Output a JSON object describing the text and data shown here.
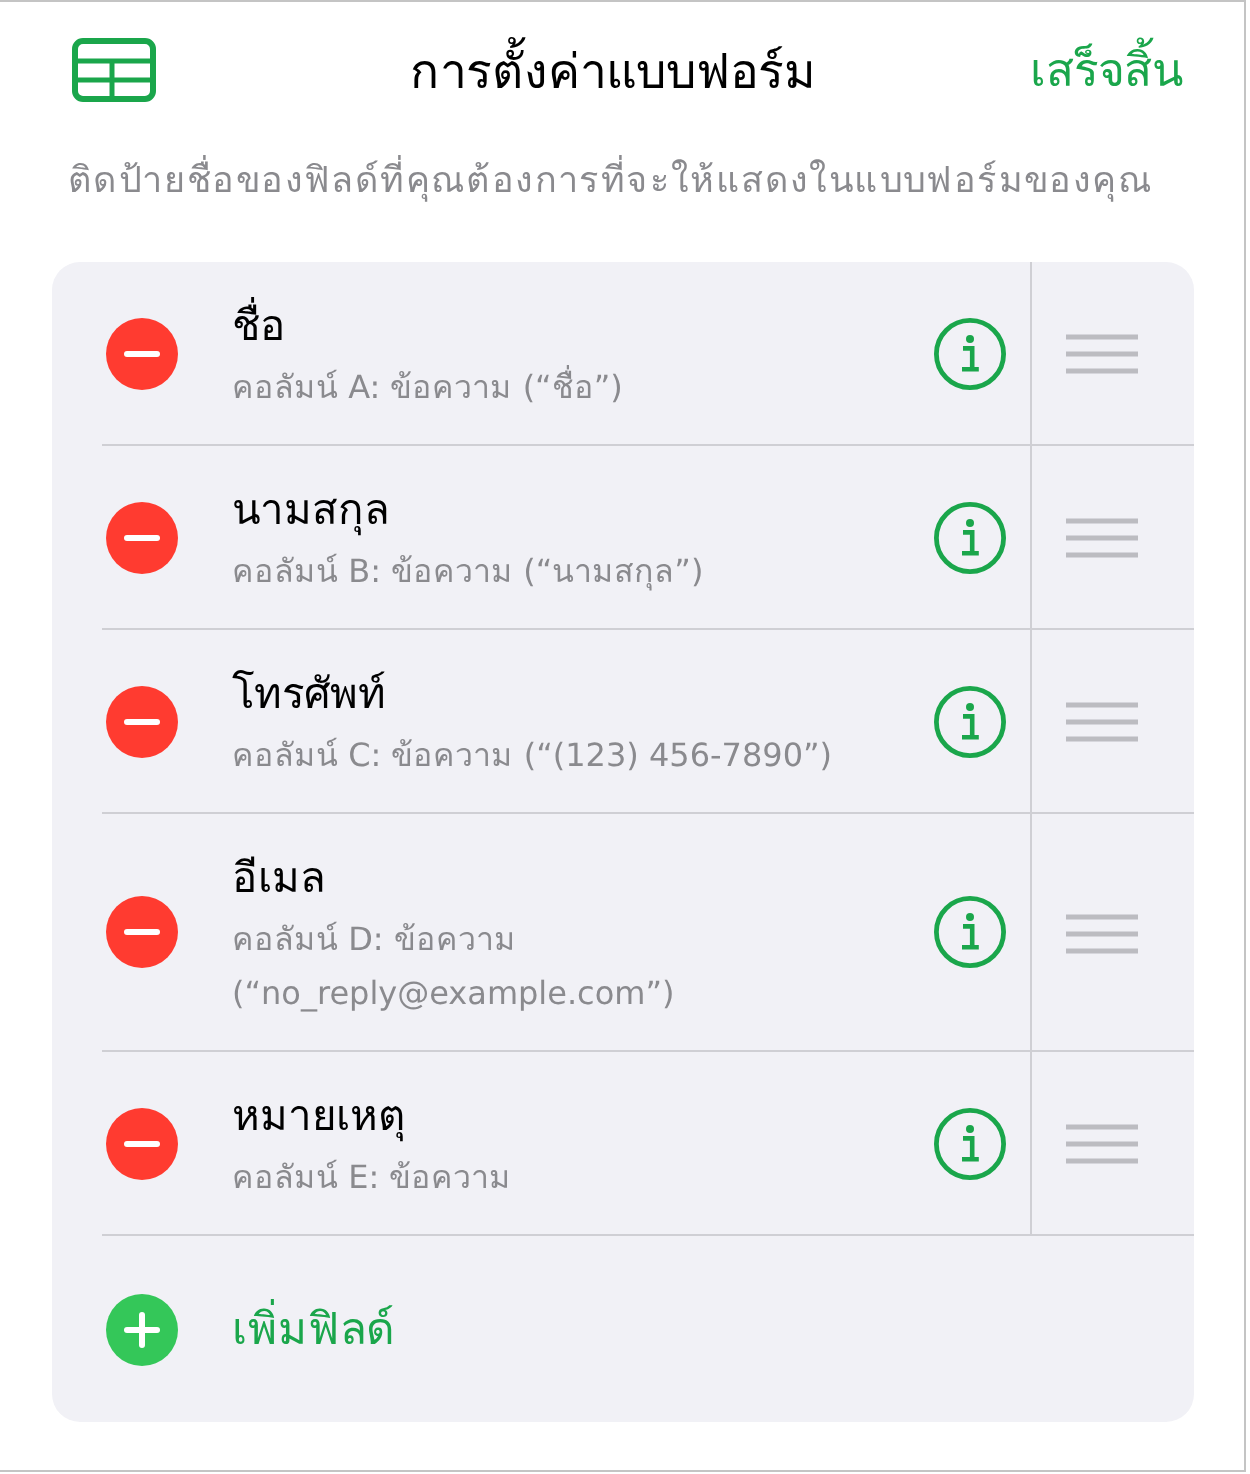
{
  "header": {
    "title": "การตั้งค่าแบบฟอร์ม",
    "done_button": "เสร็จสิ้น"
  },
  "instructions": "ติดป้ายชื่อของฟิลด์ที่คุณต้องการที่จะให้แสดงในแบบฟอร์มของคุณ",
  "fields": [
    {
      "name": "ชื่อ",
      "detail": "คอลัมน์ A: ข้อความ (“ชื่อ”)"
    },
    {
      "name": "นามสกุล",
      "detail": "คอลัมน์ B: ข้อความ (“นามสกุล”)"
    },
    {
      "name": "โทรศัพท์",
      "detail": "คอลัมน์ C: ข้อความ (“(123) 456-7890”)"
    },
    {
      "name": "อีเมล",
      "detail": "คอลัมน์ D: ข้อความ (“no_reply@example.com”)"
    },
    {
      "name": "หมายเหตุ",
      "detail": "คอลัมน์ E: ข้อความ"
    }
  ],
  "add_field": "เพิ่มฟิลด์"
}
